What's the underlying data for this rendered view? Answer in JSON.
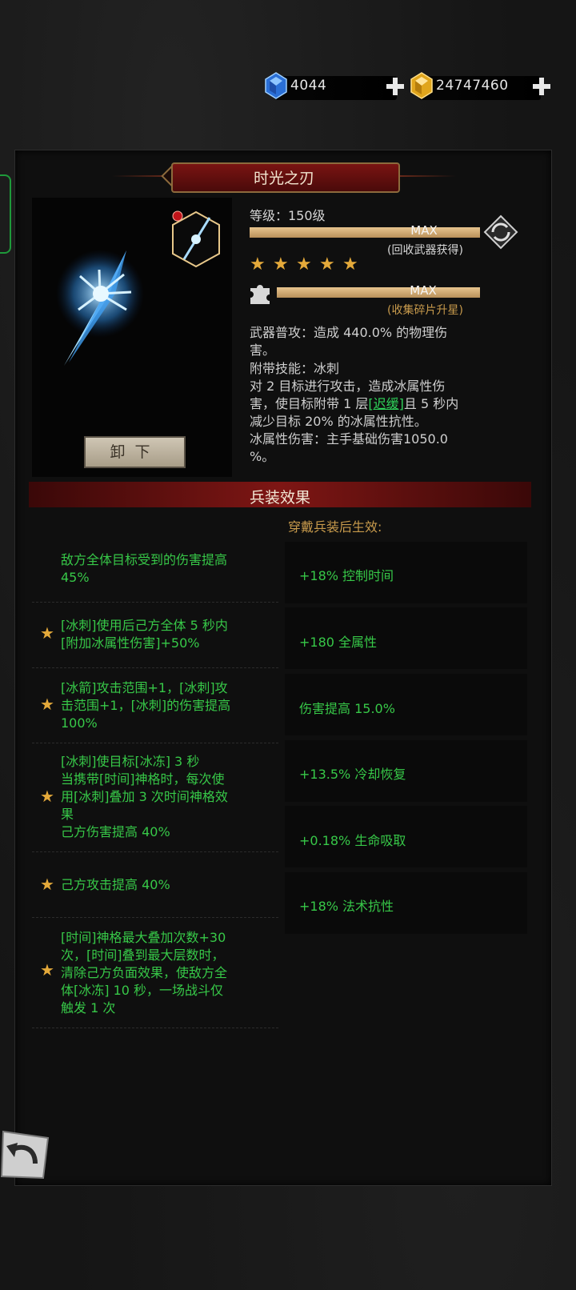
{
  "currency": {
    "gems": "4044",
    "gold": "24747460"
  },
  "weapon": {
    "name": "时光之刃",
    "level_label": "等级：150级",
    "level_bar_text": "MAX",
    "level_hint": "(回收武器获得)",
    "stars": 5,
    "star_bar_text": "MAX",
    "star_hint": "(收集碎片升星)",
    "unequip_label": "卸下",
    "desc_lines": {
      "l1": "武器普攻：造成 440.0% 的物理伤",
      "l2": "害。",
      "l3": "附带技能：冰刺",
      "l4": "对 2 目标进行攻击，造成冰属性伤",
      "l5a": "害，使目标附带 1 层",
      "l5b": "[迟缓]",
      "l5c": "且 5 秒内",
      "l6": "减少目标 20% 的冰属性抗性。",
      "l7": "冰属性伤害：主手基础伤害1050.0",
      "l8": "%。"
    }
  },
  "effects": {
    "title": "兵装效果",
    "wear_label": "穿戴兵装后生效:",
    "left": [
      {
        "star": false,
        "lines": [
          "敌方全体目标受到的伤害提高",
          "45%"
        ]
      },
      {
        "star": true,
        "lines": [
          "[冰刺]使用后己方全体 5 秒内",
          "[附加冰属性伤害]+50%"
        ]
      },
      {
        "star": true,
        "lines": [
          "[冰箭]攻击范围+1，[冰刺]攻",
          "击范围+1，[冰刺]的伤害提高",
          "100%"
        ]
      },
      {
        "star": true,
        "lines": [
          "[冰刺]使目标[冰冻] 3 秒",
          "当携带[时间]神格时，每次使",
          "用[冰刺]叠加 3 次时间神格效",
          "果",
          "己方伤害提高 40%"
        ]
      },
      {
        "star": true,
        "lines": [
          "己方攻击提高 40%"
        ]
      },
      {
        "star": true,
        "lines": [
          "[时间]神格最大叠加次数+30",
          "次，[时间]叠到最大层数时，",
          "清除己方负面效果，使敌方全",
          "体[冰冻] 10 秒，一场战斗仅",
          "触发 1 次"
        ]
      }
    ],
    "right": [
      "+18% 控制时间",
      "+180 全属性",
      "伤害提高 15.0%",
      "+13.5% 冷却恢复",
      "+0.18% 生命吸取",
      "+18% 法术抗性"
    ]
  }
}
